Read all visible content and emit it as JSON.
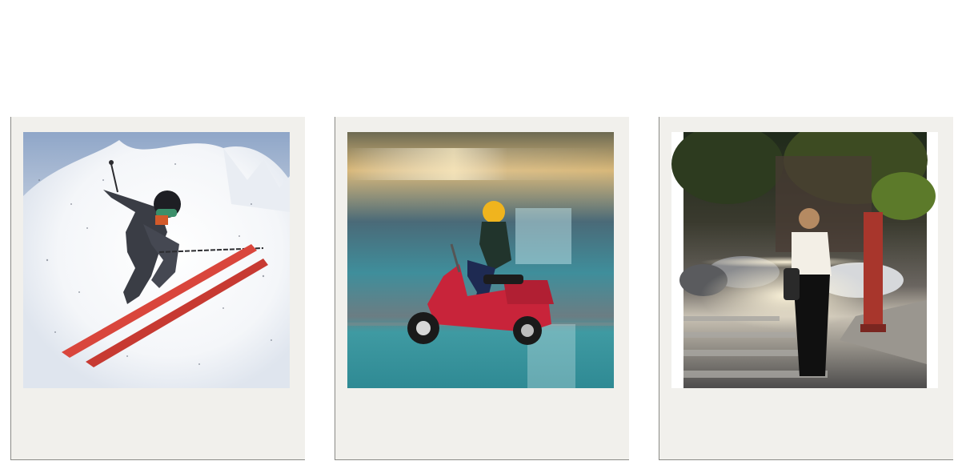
{
  "gallery": {
    "photos": [
      {
        "subject": "skier",
        "alt": ""
      },
      {
        "subject": "scooter-rider",
        "alt": ""
      },
      {
        "subject": "street-scene",
        "alt": ""
      }
    ],
    "colors": {
      "frame": "#f1f0ec",
      "frame_edge": "#8a8a86",
      "ski_red": "#d9463c",
      "scooter_red": "#c8243a",
      "helmet_yellow": "#f0b41e"
    }
  }
}
